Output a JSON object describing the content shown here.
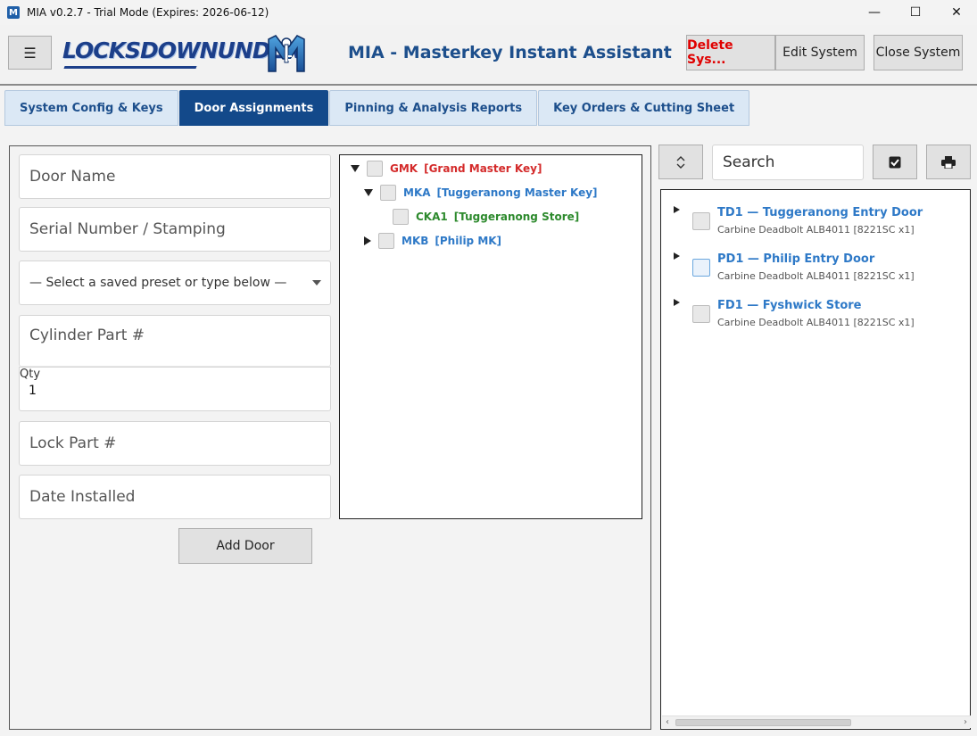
{
  "window": {
    "title": "MIA v0.2.7 - Trial Mode (Expires: 2026-06-12)",
    "icon_letter": "M",
    "controls": [
      "—",
      "☐",
      "✕"
    ]
  },
  "header": {
    "menu_icon": "☰",
    "logo_text": "LOCKSDOWNUNDER",
    "app_title": "MIA - Masterkey Instant Assistant",
    "delete_label": "Delete Sys...",
    "edit_label": "Edit System",
    "close_label": "Close System"
  },
  "tabs": [
    {
      "label": "System Config & Keys",
      "active": false
    },
    {
      "label": "Door Assignments",
      "active": true
    },
    {
      "label": "Pinning & Analysis Reports",
      "active": false
    },
    {
      "label": "Key Orders & Cutting Sheet",
      "active": false
    }
  ],
  "form": {
    "door_name_placeholder": "Door Name",
    "serial_placeholder": "Serial Number / Stamping",
    "preset_select": "— Select a saved preset or type below —",
    "cylinder_placeholder": "Cylinder Part #",
    "qty_label": "Qty",
    "qty_value": "1",
    "lock_placeholder": "Lock Part #",
    "date_placeholder": "Date Installed",
    "add_door_label": "Add Door"
  },
  "key_tree": [
    {
      "code": "GMK",
      "name": "[Grand Master Key]",
      "color": "#d42b2b",
      "expanded": true
    },
    {
      "code": "MKA",
      "name": "[Tuggeranong Master Key]",
      "color": "#2e79c7",
      "expanded": true
    },
    {
      "code": "CKA1",
      "name": "[Tuggeranong Store]",
      "color": "#2d8a2d",
      "expanded": null
    },
    {
      "code": "MKB",
      "name": "[Philip MK]",
      "color": "#2e79c7",
      "expanded": false
    }
  ],
  "search": {
    "placeholder": "Search"
  },
  "doors": [
    {
      "title": "TD1 — Tuggeranong Entry Door",
      "subtitle": "Carbine Deadbolt ALB4011  [8221SC x1]"
    },
    {
      "title": "PD1 — Philip Entry Door",
      "subtitle": "Carbine Deadbolt ALB4011  [8221SC x1]"
    },
    {
      "title": "FD1 — Fyshwick Store",
      "subtitle": "Carbine Deadbolt ALB4011  [8221SC x1]"
    }
  ],
  "colors": {
    "accent": "#13498a",
    "heading": "#1d4f8c",
    "delete": "#e00000"
  }
}
